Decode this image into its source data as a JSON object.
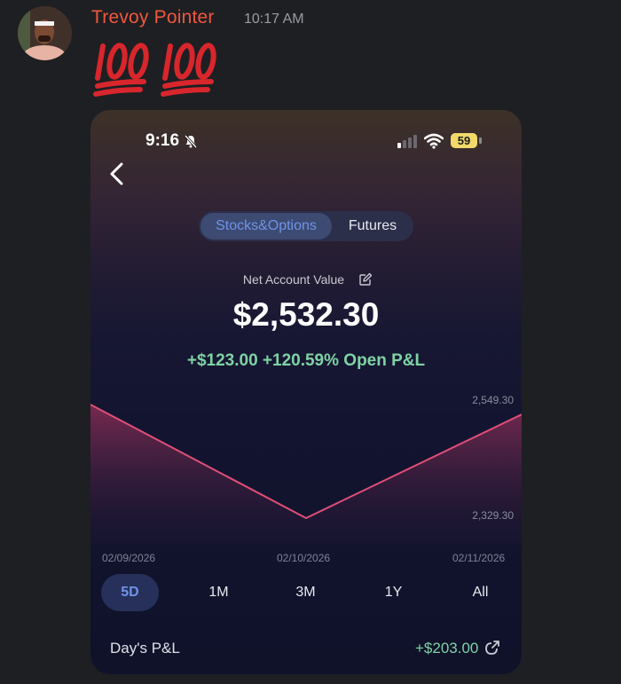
{
  "message": {
    "author": "Trevoy Pointer",
    "time": "10:17 AM",
    "emojis": [
      "100-emoji",
      "100-emoji"
    ]
  },
  "app": {
    "status_bar": {
      "time": "9:16",
      "battery": "59"
    },
    "tabs": [
      "Stocks&Options",
      "Futures"
    ],
    "active_tab": "Stocks&Options",
    "net_account_label": "Net Account Value",
    "net_account_value": "$2,532.30",
    "open_pl": "+$123.00 +120.59% Open P&L",
    "range_buttons": [
      "5D",
      "1M",
      "3M",
      "1Y",
      "All"
    ],
    "active_range": "5D",
    "days_pl_label": "Day's P&L",
    "days_pl_value": "+$203.00",
    "colors": {
      "author": "#f0573f",
      "positive": "#7ed3a4",
      "accent": "#6f93e6",
      "line": "#e04e77"
    }
  },
  "chart_data": {
    "type": "area",
    "x": [
      "02/09/2026",
      "02/10/2026",
      "02/11/2026"
    ],
    "y": [
      2549.3,
      2329.3,
      2530.0
    ],
    "ylim": [
      2329.3,
      2549.3
    ],
    "y_tick_labels": [
      "2,549.30",
      "2,329.30"
    ],
    "x_tick_labels": [
      "02/09/2026",
      "02/10/2026",
      "02/11/2026"
    ],
    "grid": false,
    "title": "",
    "xlabel": "",
    "ylabel": ""
  }
}
